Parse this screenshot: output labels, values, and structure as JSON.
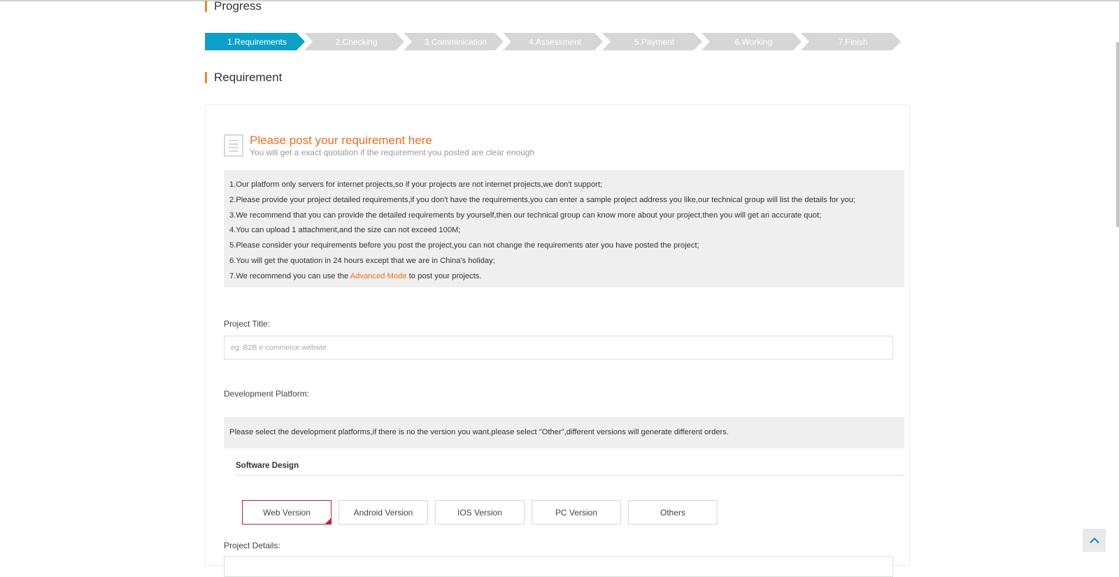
{
  "progress": {
    "title": "Progress",
    "steps": [
      {
        "label": "1.Requirements",
        "active": true
      },
      {
        "label": "2.Checking",
        "active": false
      },
      {
        "label": "3.Comminication",
        "active": false
      },
      {
        "label": "4.Assessment",
        "active": false
      },
      {
        "label": "5.Payment",
        "active": false
      },
      {
        "label": "6.Working",
        "active": false
      },
      {
        "label": "7.Finish",
        "active": false
      }
    ]
  },
  "requirement": {
    "title": "Requirement",
    "icon": "document-icon",
    "heading": "Please post your requirement here",
    "subheading": "You will get a exact quotation if the requirement you posted are clear enough",
    "rules": [
      "1.Our platform only servers for internet projects,so if your projects are not internet projects,we don't support;",
      "2.Please provide your project detailed requirements,if you don't have the requirements,you can enter a sample project address you like,our technical group will list the details for you;",
      "3.We recommend that you can provide the detailed requirements by yourself,then our technical group can know more about your project,then you will get an accurate quot;",
      "4.You can upload 1 attachment,and the size can not exceed 100M;",
      "5.Please consider your requirements before you post the project,you can not change the requirements ater you have posted the project;",
      "6.You will get the quotation in 24 hours except that we are in China's holiday;"
    ],
    "rule7": {
      "prefix": "7.We recommend you can use the ",
      "link": "Advanced Mode",
      "suffix": " to post your projects."
    }
  },
  "form": {
    "project_title_label": "Project Title:",
    "project_title_placeholder": "eg: B2B e-commerce website",
    "platform_label": "Development Platform:",
    "platform_note": "Please select the development platforms,if there is no the version you want,please select \"Other\",different versions will generate different orders.",
    "software_design_heading": "Software Design",
    "versions": [
      "Web Version",
      "Android Version",
      "IOS Version",
      "PC Version",
      "Others"
    ],
    "selected_version": "Web Version",
    "project_details_label": "Project Details:"
  },
  "colors": {
    "accent_orange": "#f36d21",
    "step_active": "#0aa0c8",
    "step_inactive": "#d6d6d6",
    "selected_border": "#c91f2f"
  },
  "back_to_top_icon": "chevron-up-icon"
}
